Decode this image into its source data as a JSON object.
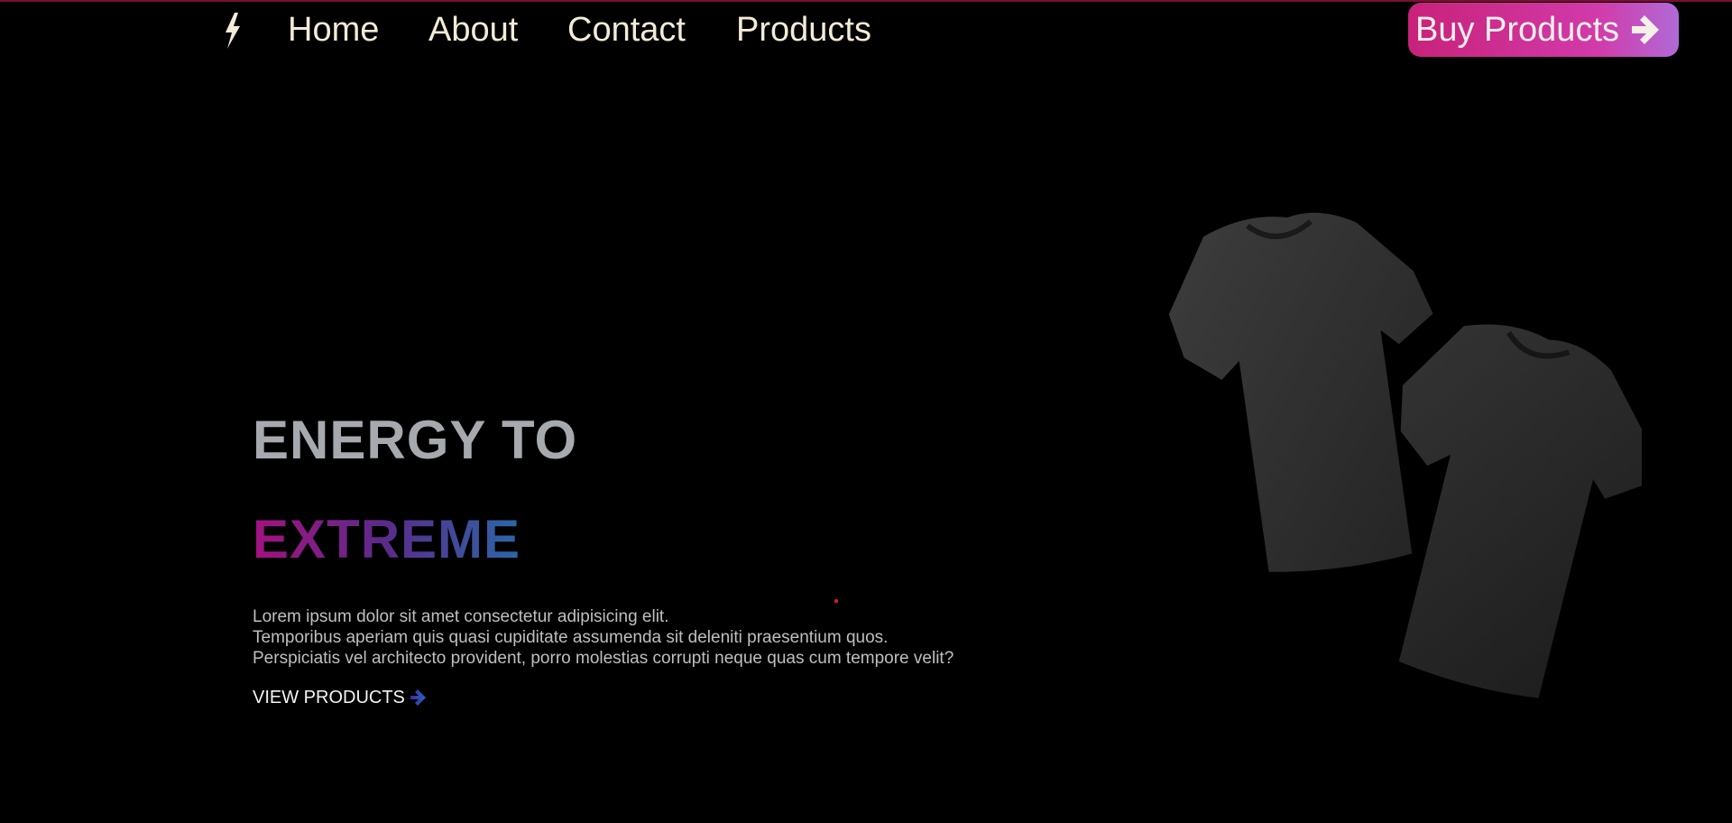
{
  "nav": {
    "logo_icon": "lightning-bolt-icon",
    "links": [
      "Home",
      "About",
      "Contact",
      "Products"
    ],
    "buy_button": {
      "label": "Buy Products",
      "icon": "arrow-right-icon"
    }
  },
  "hero": {
    "title_line1": "ENERGY TO",
    "title_line2": "EXTREME",
    "description_lines": [
      "Lorem ipsum dolor sit amet consectetur adipisicing elit.",
      "Temporibus aperiam quis quasi cupiditate assumenda sit deleniti praesentium quos.",
      "Perspiciatis vel architecto provident, porro molestias corrupti neque quas cum tempore velit?"
    ],
    "cta": {
      "label": "VIEW PRODUCTS",
      "icon": "arrow-right-icon"
    },
    "image": "two-black-tshirts"
  },
  "colors": {
    "background": "#000000",
    "nav_text": "#f3ead8",
    "title_gray": "#a6a9ad",
    "gradient_start": "#a3127f",
    "gradient_end": "#2a67a8",
    "button_gradient_start": "#c8227a",
    "button_gradient_end": "#b06ad6"
  }
}
